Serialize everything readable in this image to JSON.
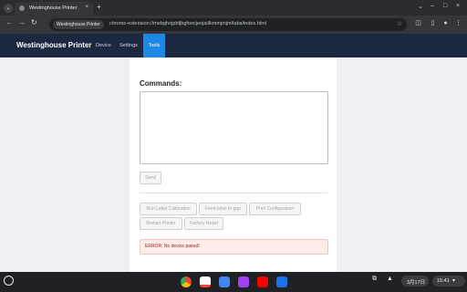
{
  "browser": {
    "tab_title": "Westinghouse Printer",
    "tab_close": "×",
    "new_tab": "+",
    "site_chip": "Westinghouse Printer",
    "url": "chrome-extension://mebghojpbfjbgfoocjeojaiilkmmjmjm/tabs/index.html",
    "window_controls": [
      "⌄",
      "–",
      "□",
      "×"
    ]
  },
  "app": {
    "brand": "Westinghouse Printer",
    "nav": [
      "Device",
      "Settings",
      "Tools"
    ],
    "active_nav": "Tools"
  },
  "tools": {
    "commands_label": "Commands:",
    "send_label": "Send",
    "buttons": [
      "Run Label Calibration",
      "Feed label to gap",
      "Print Configuration",
      "Restart Printer",
      "Factory Reset"
    ],
    "error": "ERROR: No device paired!"
  },
  "shelf": {
    "date": "3月17日",
    "time": "15:41",
    "apps": [
      "chrome",
      "gmail",
      "docs",
      "photos",
      "youtube",
      "files"
    ]
  },
  "colors": {
    "appbar": "#1b2840",
    "active_tab": "#1e88e5",
    "error_bg": "#fdecea",
    "error_text": "#8a2b22"
  }
}
